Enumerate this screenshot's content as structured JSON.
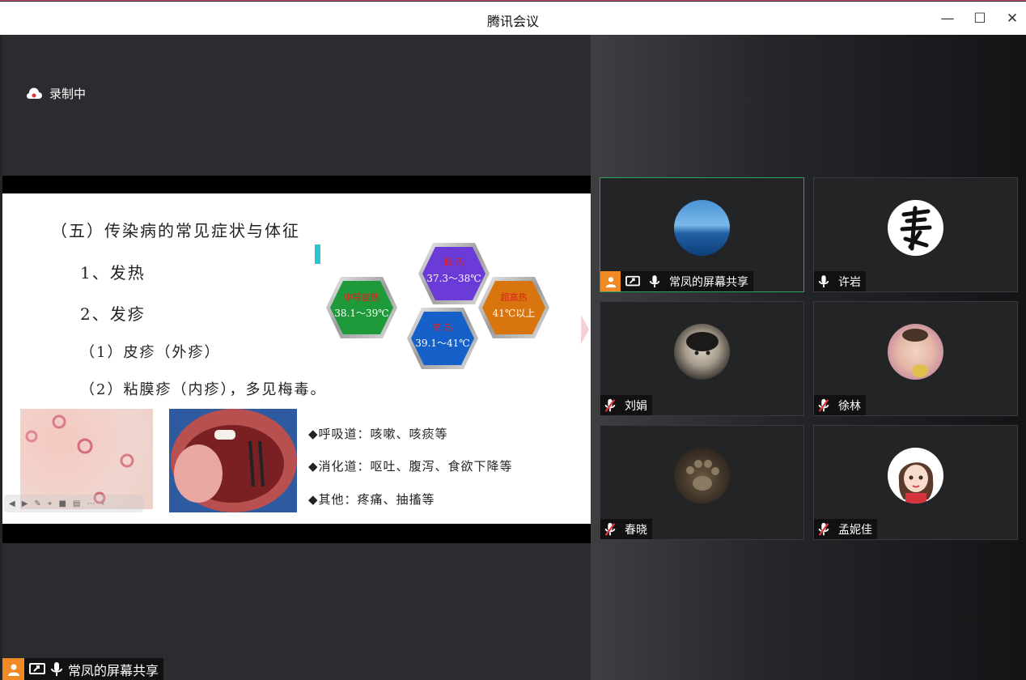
{
  "app": {
    "title": "腾讯会议"
  },
  "window_controls": {
    "minimize": "—",
    "maximize": "☐",
    "close": "✕"
  },
  "recording": {
    "label": "录制中"
  },
  "slide": {
    "heading": "（五）传染病的常见症状与体征",
    "item1": "1、发热",
    "item2": "2、发疹",
    "sub1": "（1）皮疹（外疹）",
    "sub2": "（2）粘膜疹（内疹），多见梅毒。",
    "bullets": [
      "◆呼吸道：咳嗽、咳痰等",
      "◆消化道：呕吐、腹泻、食欲下降等",
      "◆其他：疼痛、抽搐等"
    ],
    "fever_levels": [
      {
        "name": "低 热",
        "range": "37.3～38℃",
        "color": "#6a3bd6"
      },
      {
        "name": "中等度热",
        "range": "38.1～39℃",
        "color": "#1f9a3a"
      },
      {
        "name": "超高热",
        "range": "41℃以上",
        "color": "#d9750f"
      },
      {
        "name": "高 热",
        "range": "39.1～41℃",
        "color": "#1560c9"
      }
    ]
  },
  "screen_share": {
    "label": "常凤的屏幕共享"
  },
  "participants": [
    {
      "name": "常凤的屏幕共享",
      "muted": false,
      "active": true,
      "avatar": "sea-avatar"
    },
    {
      "name": "许岩",
      "muted": false,
      "active": false,
      "avatar": "calligraphy-avatar"
    },
    {
      "name": "刘娟",
      "muted": true,
      "active": false,
      "avatar": "child-photo-avatar"
    },
    {
      "name": "徐林",
      "muted": true,
      "active": false,
      "avatar": "baby-photo-avatar"
    },
    {
      "name": "春晓",
      "muted": true,
      "active": false,
      "avatar": "paw-avatar"
    },
    {
      "name": "孟妮佳",
      "muted": true,
      "active": false,
      "avatar": "cartoon-girl-avatar"
    }
  ]
}
